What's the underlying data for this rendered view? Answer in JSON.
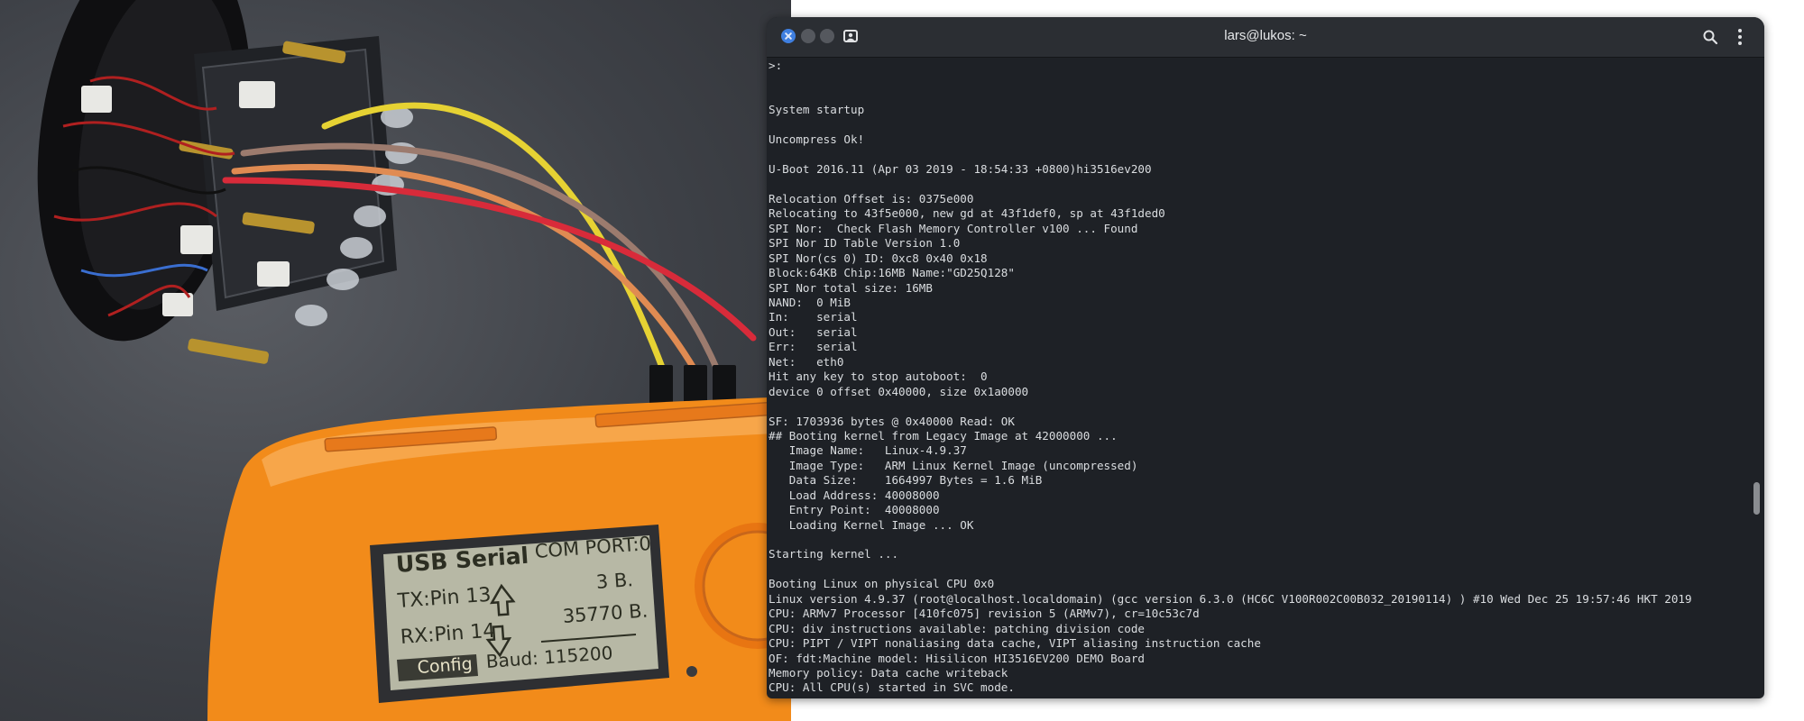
{
  "photo": {
    "device_screen": {
      "title": "USB Serial",
      "com_port": "COM PORT:0",
      "tx_label": "TX:Pin 13",
      "tx_bytes": "3 B.",
      "rx_label": "RX:Pin 14",
      "rx_bytes": "35770 B.",
      "config_label": "Config",
      "baud": "Baud: 115200"
    }
  },
  "terminal": {
    "title": "lars@lukos: ~",
    "icons": {
      "close": "close-icon",
      "profile": "new-tab-profile-icon",
      "search": "search-icon",
      "menu": "kebab-menu-icon"
    },
    "accent_color": "#3f7fe0",
    "lines": [
      ">:",
      "",
      "",
      "System startup",
      "",
      "Uncompress Ok!",
      "",
      "U-Boot 2016.11 (Apr 03 2019 - 18:54:33 +0800)hi3516ev200",
      "",
      "Relocation Offset is: 0375e000",
      "Relocating to 43f5e000, new gd at 43f1def0, sp at 43f1ded0",
      "SPI Nor:  Check Flash Memory Controller v100 ... Found",
      "SPI Nor ID Table Version 1.0",
      "SPI Nor(cs 0) ID: 0xc8 0x40 0x18",
      "Block:64KB Chip:16MB Name:\"GD25Q128\"",
      "SPI Nor total size: 16MB",
      "NAND:  0 MiB",
      "In:    serial",
      "Out:   serial",
      "Err:   serial",
      "Net:   eth0",
      "Hit any key to stop autoboot:  0",
      "device 0 offset 0x40000, size 0x1a0000",
      "",
      "SF: 1703936 bytes @ 0x40000 Read: OK",
      "## Booting kernel from Legacy Image at 42000000 ...",
      "   Image Name:   Linux-4.9.37",
      "   Image Type:   ARM Linux Kernel Image (uncompressed)",
      "   Data Size:    1664997 Bytes = 1.6 MiB",
      "   Load Address: 40008000",
      "   Entry Point:  40008000",
      "   Loading Kernel Image ... OK",
      "",
      "Starting kernel ...",
      "",
      "Booting Linux on physical CPU 0x0",
      "Linux version 4.9.37 (root@localhost.localdomain) (gcc version 6.3.0 (HC6C V100R002C00B032_20190114) ) #10 Wed Dec 25 19:57:46 HKT 2019",
      "CPU: ARMv7 Processor [410fc075] revision 5 (ARMv7), cr=10c53c7d",
      "CPU: div instructions available: patching division code",
      "CPU: PIPT / VIPT nonaliasing data cache, VIPT aliasing instruction cache",
      "OF: fdt:Machine model: Hisilicon HI3516EV200 DEMO Board",
      "Memory policy: Data cache writeback",
      "CPU: All CPU(s) started in SVC mode."
    ]
  }
}
